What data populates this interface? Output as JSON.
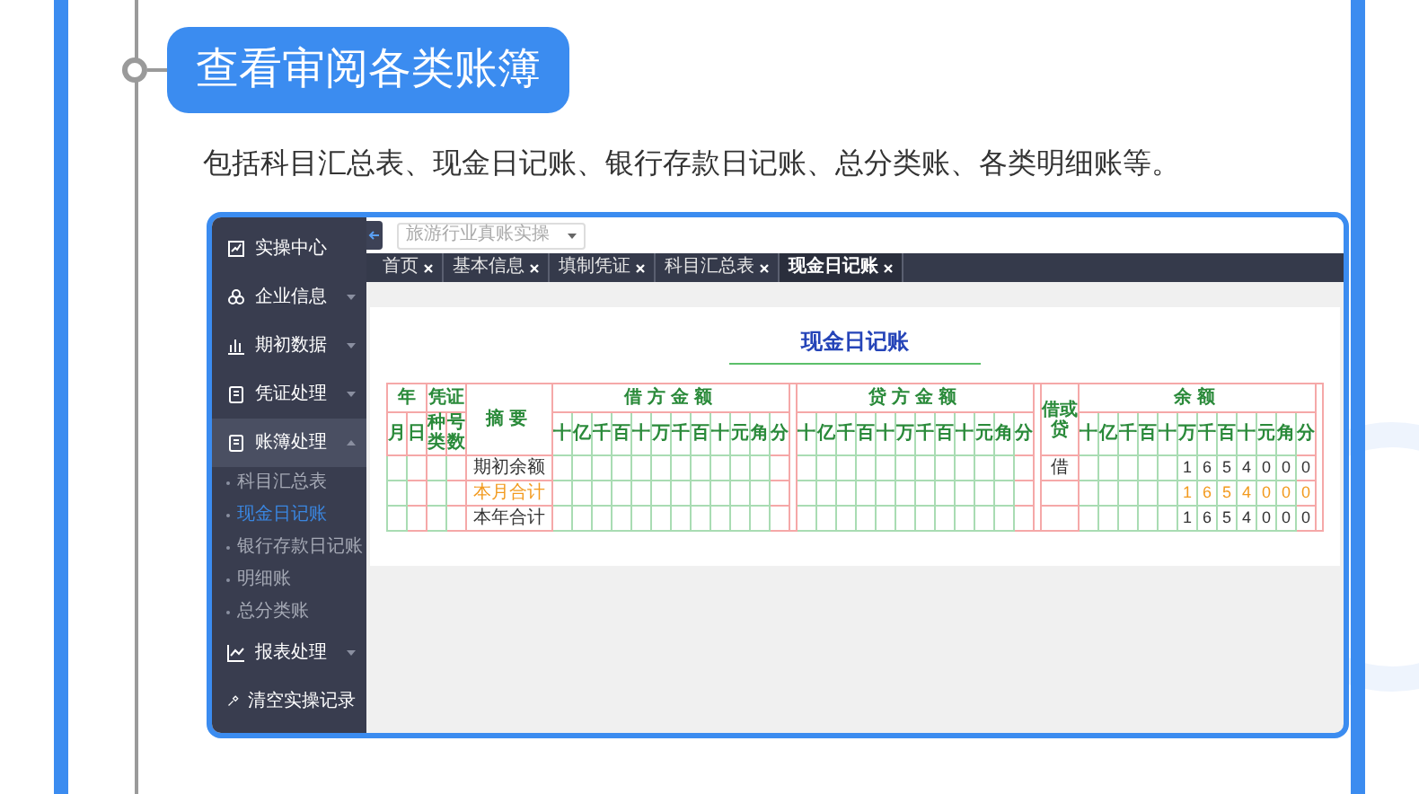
{
  "heading": "查看审阅各类账簿",
  "description": "包括科目汇总表、现金日记账、银行存款日记账、总分类账、各类明细账等。",
  "app": {
    "sidebar": {
      "items": [
        {
          "label": "实操中心",
          "selected": false
        },
        {
          "label": "企业信息",
          "selected": false,
          "expanded": false
        },
        {
          "label": "期初数据",
          "selected": false,
          "expanded": false
        },
        {
          "label": "凭证处理",
          "selected": false,
          "expanded": false
        },
        {
          "label": "账簿处理",
          "selected": true,
          "expanded": true,
          "children": [
            {
              "label": "科目汇总表",
              "selected": false
            },
            {
              "label": "现金日记账",
              "selected": true
            },
            {
              "label": "银行存款日记账",
              "selected": false
            },
            {
              "label": "明细账",
              "selected": false
            },
            {
              "label": "总分类账",
              "selected": false
            }
          ]
        },
        {
          "label": "报表处理",
          "selected": false,
          "expanded": false
        },
        {
          "label": "清空实操记录",
          "selected": false
        }
      ]
    },
    "company_select": {
      "value": "旅游行业真账实操"
    },
    "tabs": [
      {
        "label": "首页",
        "selected": false
      },
      {
        "label": "基本信息",
        "selected": false
      },
      {
        "label": "填制凭证",
        "selected": false
      },
      {
        "label": "科目汇总表",
        "selected": false
      },
      {
        "label": "现金日记账",
        "selected": true
      }
    ],
    "ledger": {
      "title": "现金日记账",
      "headers": {
        "year": "年",
        "voucher": "凭证",
        "month": "月",
        "day": "日",
        "type": "种类",
        "number": "号数",
        "summary": "摘要",
        "debit": "借方金额",
        "credit": "贷方金额",
        "direction": "借或贷",
        "balance": "余额"
      },
      "debit_units": [
        "十",
        "亿",
        "千",
        "百",
        "十",
        "万",
        "千",
        "百",
        "十",
        "元",
        "角",
        "分"
      ],
      "credit_units": [
        "十",
        "亿",
        "千",
        "百",
        "十",
        "万",
        "千",
        "百",
        "十",
        "元",
        "角",
        "分"
      ],
      "balance_units": [
        "十",
        "亿",
        "千",
        "百",
        "十",
        "万",
        "千",
        "百",
        "十",
        "元",
        "角",
        "分"
      ],
      "rows": [
        {
          "summary": "期初余额",
          "highlighted": false,
          "direction": "借",
          "balance_digits": [
            "1",
            "6",
            "5",
            "4",
            "0",
            "0",
            "0"
          ]
        },
        {
          "summary": "本月合计",
          "highlighted": true,
          "balance_digits": [
            "1",
            "6",
            "5",
            "4",
            "0",
            "0",
            "0"
          ]
        },
        {
          "summary": "本年合计",
          "highlighted": false,
          "balance_digits": [
            "1",
            "6",
            "5",
            "4",
            "0",
            "0",
            "0"
          ]
        }
      ]
    }
  }
}
